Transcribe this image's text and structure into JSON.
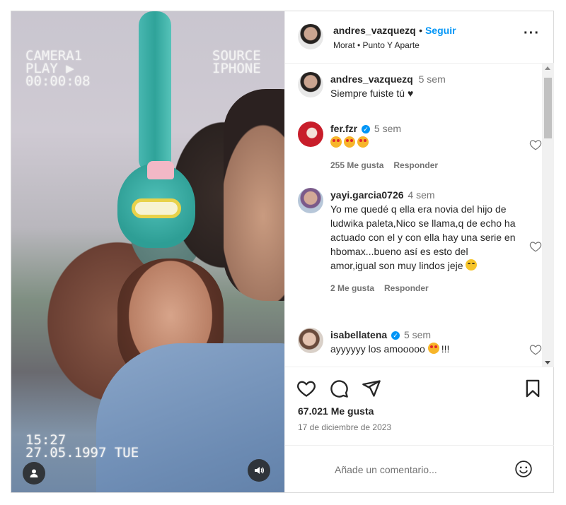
{
  "media": {
    "vhs_top_left": "CAMERA1\nPLAY ▶\n00:00:08",
    "vhs_top_right": "SOURCE\nIPHONE",
    "vhs_bottom_left": "15:27\n27.05.1997 TUE"
  },
  "header": {
    "username": "andres_vazquezq",
    "follow": "Seguir",
    "song": "Morat • Punto Y Aparte"
  },
  "caption": {
    "username": "andres_vazquezq",
    "time": "5 sem",
    "text": "Siempre fuiste tú"
  },
  "comments": [
    {
      "username": "fer.fzr",
      "verified": true,
      "time": "5 sem",
      "text": "",
      "likes": "255 Me gusta",
      "reply": "Responder"
    },
    {
      "username": "yayi.garcia0726",
      "verified": false,
      "time": "4 sem",
      "text": "Yo me quedé q ella era novia del hijo de ludwika paleta,Nico se llama,q de echo ha actuado con el y con ella hay una serie en hbomax...bueno así es esto del amor,igual son muy lindos jeje",
      "likes": "2 Me gusta",
      "reply": "Responder"
    },
    {
      "username": "isabellatena",
      "verified": true,
      "time": "5 sem",
      "text": "ayyyyyy los amooooo",
      "text_suffix": "!!!"
    }
  ],
  "footer": {
    "likes": "67.021 Me gusta",
    "date": "17 de diciembre de 2023",
    "add_comment_placeholder": "Añade un comentario..."
  },
  "icons": {
    "like": "heart-icon",
    "comment": "comment-icon",
    "share": "send-icon",
    "save": "bookmark-icon",
    "emoji": "emoji-icon",
    "more": "more-icon",
    "sound": "speaker-icon",
    "tags": "user-icon"
  },
  "colors": {
    "accent": "#0095f6",
    "text": "#262626",
    "secondary": "#737373"
  }
}
